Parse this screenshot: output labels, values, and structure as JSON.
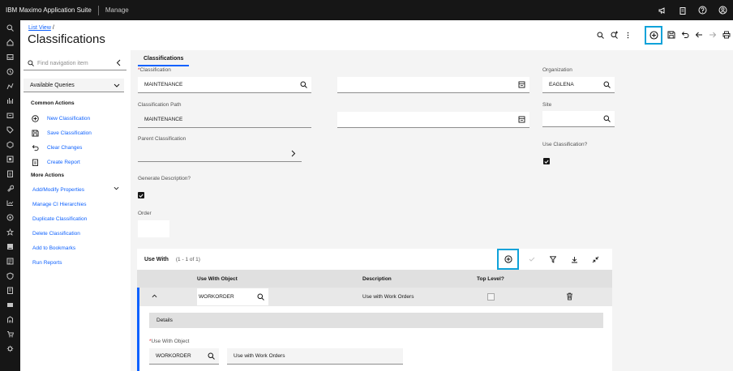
{
  "topbar": {
    "brand": "IBM Maximo Application Suite",
    "app": "Manage",
    "icons": [
      "megaphone-icon",
      "clipboard-icon",
      "help-icon",
      "user-avatar-icon"
    ]
  },
  "rail": {
    "icons": [
      "search-icon",
      "home-icon",
      "inbox-icon",
      "history-icon",
      "person-icon",
      "chart-icon",
      "folder-icon",
      "tag-icon",
      "cube-icon",
      "settings-icon",
      "clipboard-icon",
      "wrench-icon",
      "hierarchy-icon",
      "truck-icon",
      "calendar-icon",
      "report-icon",
      "list-icon",
      "shield-icon",
      "lock-icon",
      "card-icon",
      "building-icon",
      "cart-icon",
      "gear-icon"
    ]
  },
  "header": {
    "breadcrumb_link": "List View",
    "breadcrumb_sep": "/",
    "title": "Classifications"
  },
  "sidenav": {
    "search_placeholder": "Find navigation item",
    "queries_label": "Available Queries",
    "common_actions_title": "Common Actions",
    "common_actions": [
      {
        "label": "New Classification",
        "icon": "add-circle-icon"
      },
      {
        "label": "Save Classification",
        "icon": "save-icon"
      },
      {
        "label": "Clear Changes",
        "icon": "undo-icon"
      },
      {
        "label": "Create Report",
        "icon": "report-icon"
      }
    ],
    "more_actions_title": "More Actions",
    "more_actions": [
      "Add/Modify Properties",
      "Manage CI Hierarchies",
      "Duplicate Classification",
      "Delete Classification",
      "Add to Bookmarks",
      "Run Reports"
    ]
  },
  "main": {
    "tab": "Classifications",
    "fields": {
      "classification_label": "Classification",
      "classification_value": "MAINTENANCE",
      "path_label": "Classification Path",
      "path_value": "MAINTENANCE",
      "parent_label": "Parent Classification",
      "generate_label": "Generate Description?",
      "generate_checked": true,
      "order_label": "Order",
      "organization_label": "Organization",
      "organization_value": "EAGLENA",
      "site_label": "Site",
      "use_class_label": "Use Classification?",
      "use_class_checked": true
    },
    "use_with": {
      "title": "Use With",
      "count": "(1 - 1 of 1)",
      "columns": [
        "Use With Object",
        "Description",
        "Top Level?"
      ],
      "row": {
        "object": "WORKORDER",
        "description": "Use with Work Orders",
        "top_level": false
      },
      "details_title": "Details",
      "detail_label": "Use With Object",
      "detail_object": "WORKORDER",
      "detail_description": "Use with Work Orders"
    }
  }
}
